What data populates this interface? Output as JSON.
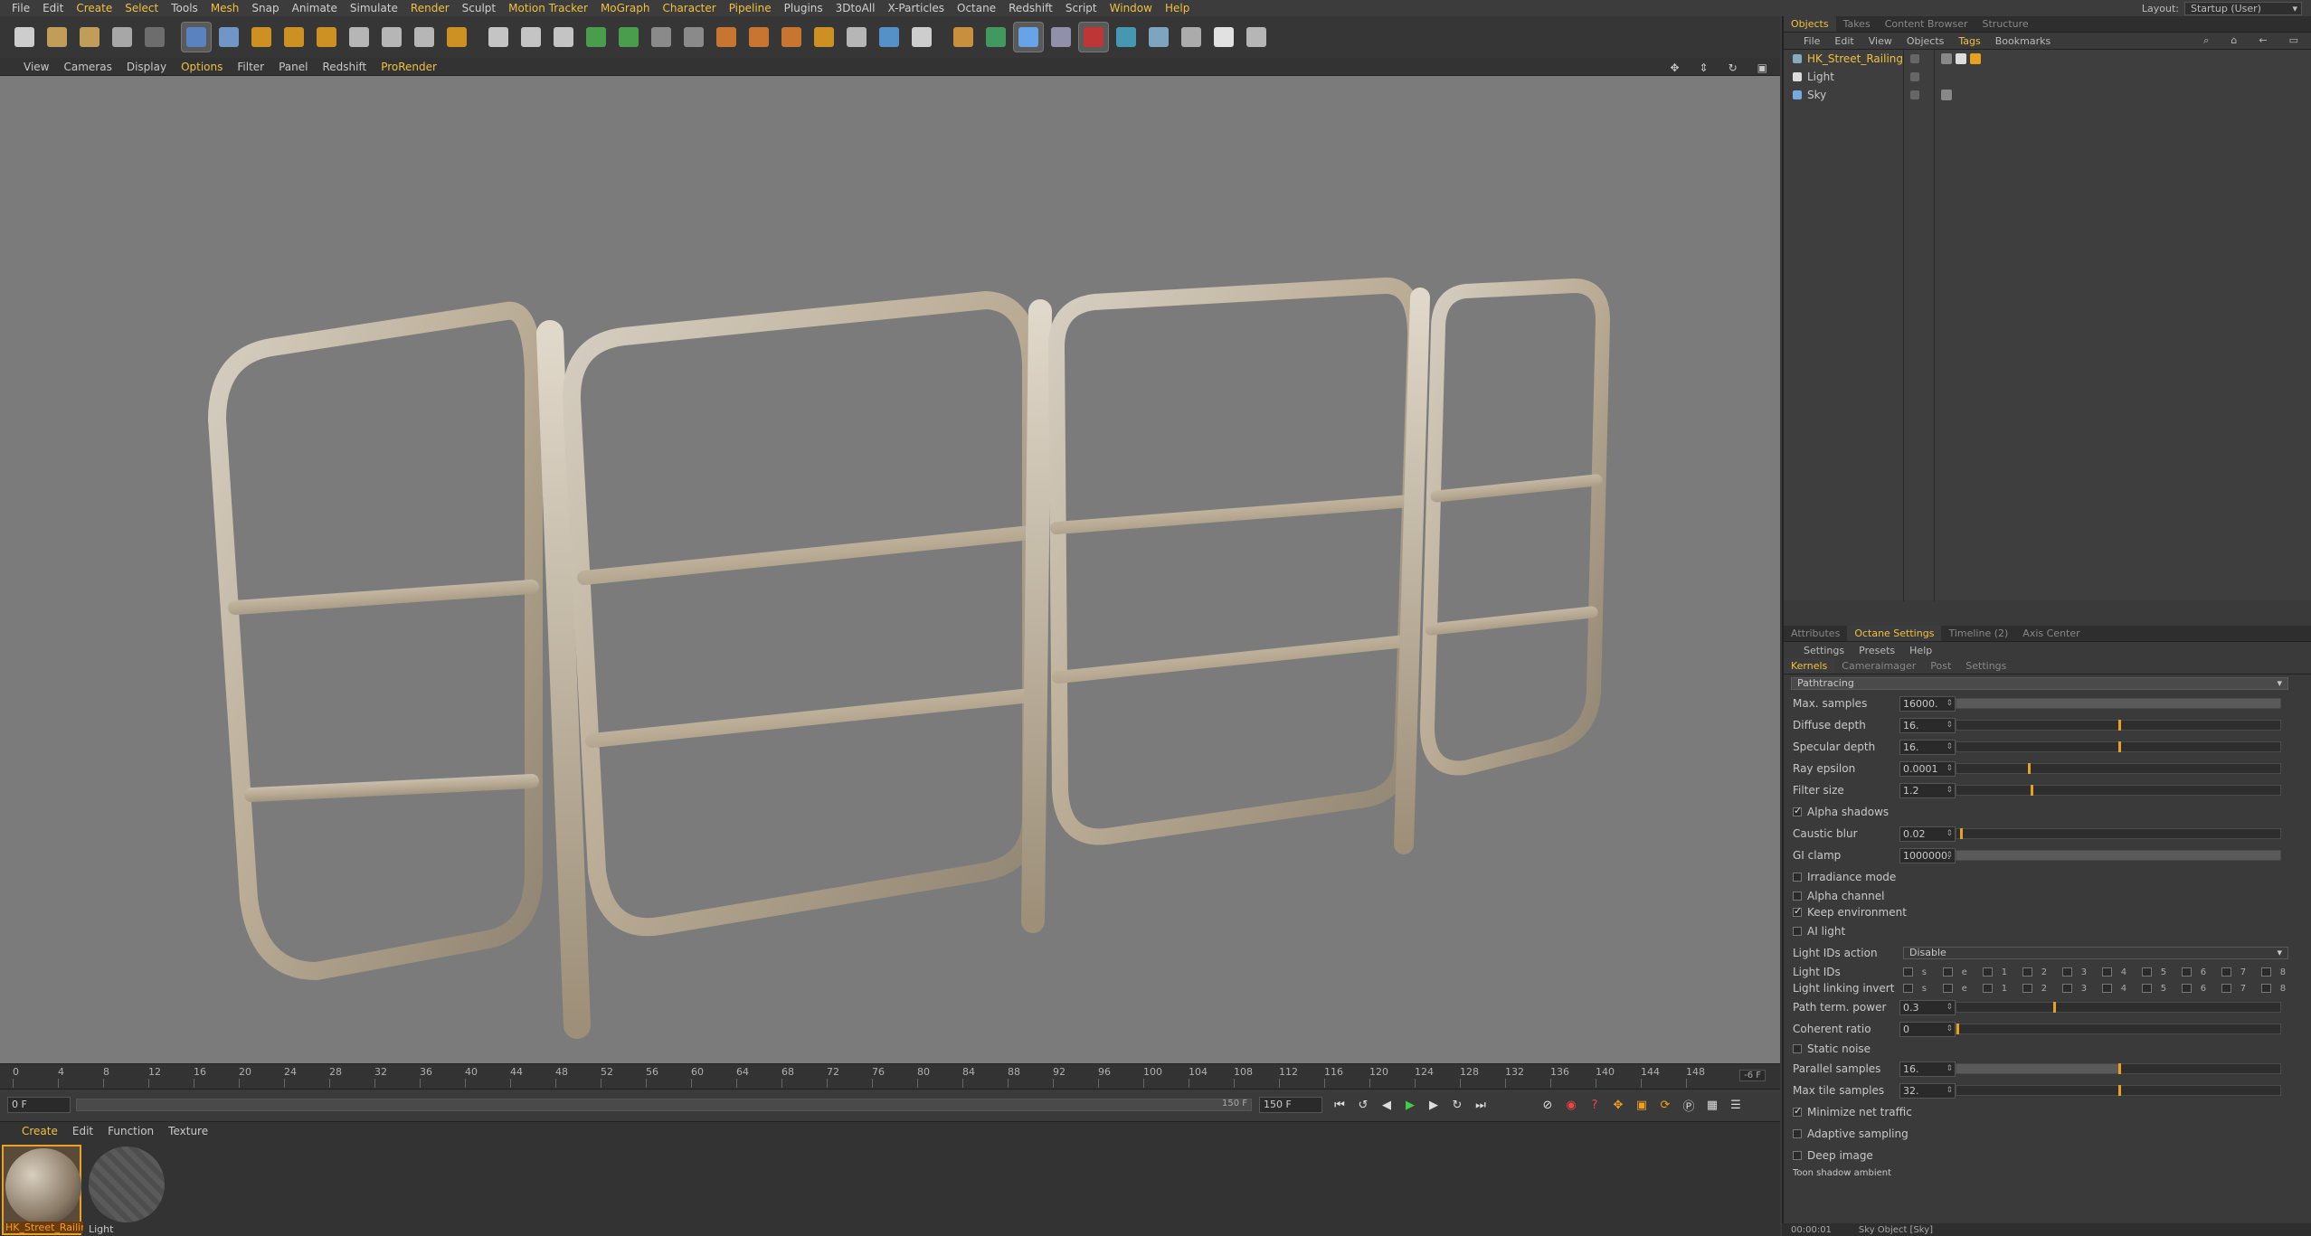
{
  "menubar": {
    "items": [
      "File",
      "Edit",
      "Create",
      "Select",
      "Tools",
      "Mesh",
      "Snap",
      "Animate",
      "Simulate",
      "Render",
      "Sculpt",
      "Motion Tracker",
      "MoGraph",
      "Character",
      "Pipeline",
      "Plugins",
      "3DtoAll",
      "X-Particles",
      "Octane",
      "Redshift",
      "Script",
      "Window",
      "Help"
    ],
    "highlighted": [
      2,
      3,
      5,
      9,
      11,
      12,
      13,
      14,
      21,
      22
    ],
    "layout_label": "Layout:",
    "layout_value": "Startup (User)"
  },
  "toolbar": {
    "icons": [
      "new-document-icon",
      "open-icon",
      "save-icon",
      "undo-icon",
      "redo-icon",
      "select-arrow-icon",
      "move-icon",
      "scale-icon",
      "rotate-icon",
      "add-icon",
      "x-axis-icon",
      "y-axis-icon",
      "z-axis-icon",
      "world-coord-icon",
      "render-region-icon",
      "render-view-icon",
      "render-settings-icon",
      "sphere-primitive-icon",
      "deformer-icon",
      "cube-icon",
      "cube-alt-icon",
      "generator-icon",
      "spline-icon",
      "scene-icon",
      "axis-icon",
      "floor-icon",
      "camera-icon",
      "light-icon",
      "brush-icon",
      "octane-live-icon",
      "octane-settings-icon",
      "tag-icon",
      "record-icon",
      "contrast-icon",
      "sky-icon",
      "hdri-icon",
      "white-icon",
      "film-icon"
    ]
  },
  "viewport_menu": {
    "items": [
      "View",
      "Cameras",
      "Display",
      "Options",
      "Filter",
      "Panel",
      "Redshift",
      "ProRender"
    ],
    "highlighted": [
      3,
      7
    ]
  },
  "timeline": {
    "ticks": [
      "0",
      "4",
      "8",
      "12",
      "16",
      "20",
      "24",
      "28",
      "32",
      "36",
      "40",
      "44",
      "48",
      "52",
      "56",
      "60",
      "64",
      "68",
      "72",
      "76",
      "80",
      "84",
      "88",
      "92",
      "96",
      "100",
      "104",
      "108",
      "112",
      "116",
      "120",
      "124",
      "128",
      "132",
      "136",
      "140",
      "144",
      "148"
    ],
    "current_frame_indicator": "-6 F",
    "start_field": "0 F",
    "end_field_inner": "150 F",
    "end_field": "150 F",
    "start_marker": "0 F"
  },
  "material_menu": {
    "items": [
      "Create",
      "Edit",
      "Function",
      "Texture"
    ],
    "highlighted": [
      0
    ]
  },
  "materials": [
    {
      "name": "HK_Street_Railing",
      "selected": true
    },
    {
      "name": "Light",
      "selected": false
    }
  ],
  "objects_panel": {
    "tabs": [
      "Objects",
      "Takes",
      "Content Browser",
      "Structure"
    ],
    "active_tab": 0,
    "menu": [
      "File",
      "Edit",
      "View",
      "Objects",
      "Tags",
      "Bookmarks"
    ],
    "menu_highlight": 4,
    "rows": [
      {
        "name": "HK_Street_Railing",
        "highlight": true,
        "icon": "null-object-icon"
      },
      {
        "name": "Light",
        "highlight": false,
        "icon": "light-object-icon"
      },
      {
        "name": "Sky",
        "highlight": false,
        "icon": "sky-object-icon"
      }
    ]
  },
  "attr_panel": {
    "tabs": [
      "Attributes",
      "Octane Settings",
      "Timeline (2)",
      "Axis Center"
    ],
    "active_tab": 1,
    "menu": [
      "Settings",
      "Presets",
      "Help"
    ],
    "subtabs": [
      "Kernels",
      "Cameraimager",
      "Post",
      "Settings"
    ],
    "active_subtab": 0,
    "kernel": "Pathtracing",
    "fields": [
      {
        "label": "Max. samples",
        "value": "16000.",
        "fill": 1.0,
        "mark": null
      },
      {
        "label": "Diffuse depth",
        "value": "16.",
        "fill": 0.0,
        "mark": 0.5
      },
      {
        "label": "Specular depth",
        "value": "16.",
        "fill": 0.0,
        "mark": 0.5
      },
      {
        "label": "Ray epsilon",
        "value": "0.0001",
        "fill": 0.0,
        "mark": 0.22
      },
      {
        "label": "Filter size",
        "value": "1.2",
        "fill": 0.0,
        "mark": 0.23
      }
    ],
    "alpha_shadows": "Alpha shadows",
    "fields2": [
      {
        "label": "Caustic blur",
        "value": "0.02",
        "fill": 0.0,
        "mark": 0.01
      },
      {
        "label": "GI clamp",
        "value": "1000000.",
        "fill": 1.0,
        "mark": null
      }
    ],
    "irradiance_mode": "Irradiance mode",
    "alpha_channel": "Alpha channel",
    "keep_environment": "Keep environment",
    "ai_light": "AI light",
    "light_ids_action_label": "Light IDs action",
    "light_ids_action_value": "Disable",
    "light_ids_label": "Light IDs",
    "light_linking_label": "Light linking invert",
    "id_names": [
      "s",
      "e",
      "1",
      "2",
      "3",
      "4",
      "5",
      "6",
      "7",
      "8"
    ],
    "fields3": [
      {
        "label": "Path term. power",
        "value": "0.3",
        "fill": 0.0,
        "mark": 0.3
      },
      {
        "label": "Coherent ratio",
        "value": "0",
        "fill": 0.0,
        "mark": 0.0
      }
    ],
    "static_noise": "Static noise",
    "fields4": [
      {
        "label": "Parallel samples",
        "value": "16.",
        "fill": 0.5,
        "mark": 0.5
      },
      {
        "label": "Max tile samples",
        "value": "32.",
        "fill": 0.0,
        "mark": 0.5
      }
    ],
    "minimize_net_traffic": "Minimize net traffic",
    "adaptive_sampling": "Adaptive sampling",
    "deep_image": "Deep image",
    "cutoff_label": "Toon shadow ambient"
  },
  "status": {
    "time": "00:00:01",
    "text": "Sky Object [Sky]"
  }
}
